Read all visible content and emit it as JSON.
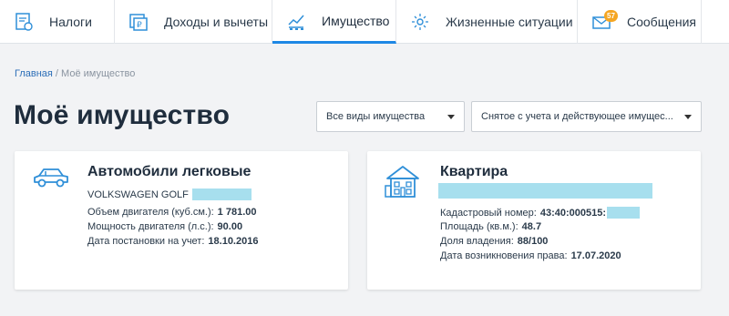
{
  "nav": {
    "items": [
      {
        "label": "Налоги",
        "icon": "tax-doc-icon"
      },
      {
        "label": "Доходы и вычеты",
        "icon": "income-deductions-icon"
      },
      {
        "label": "Имущество",
        "icon": "property-chart-icon",
        "active": true
      },
      {
        "label": "Жизненные ситуации",
        "icon": "life-situations-icon"
      },
      {
        "label": "Сообщения",
        "icon": "messages-envelope-icon",
        "badge": "57"
      }
    ]
  },
  "breadcrumb": {
    "home": "Главная",
    "separator": " / ",
    "current": "Моё имущество"
  },
  "page": {
    "title": "Моё имущество"
  },
  "filters": {
    "type": {
      "value": "Все виды имущества"
    },
    "status": {
      "value": "Снятое с учета и действующее имущес..."
    }
  },
  "cards": {
    "car": {
      "title": "Автомобили легковые",
      "model": "VOLKSWAGEN GOLF",
      "engine_volume_label": "Объем двигателя (куб.см.):",
      "engine_volume_value": "1 781.00",
      "power_label": "Мощность двигателя (л.с.):",
      "power_value": "90.00",
      "registration_label": "Дата постановки на учет:",
      "registration_value": "18.10.2016"
    },
    "flat": {
      "title": "Квартира",
      "cadastral_label": "Кадастровый номер:",
      "cadastral_value": "43:40:000515:",
      "area_label": "Площадь (кв.м.):",
      "area_value": "48.7",
      "share_label": "Доля владения:",
      "share_value": "88/100",
      "rights_label": "Дата возникновения права:",
      "rights_value": "17.07.2020"
    }
  },
  "colors": {
    "accent": "#1e88e5",
    "badge": "#f5a623",
    "redaction": "#a7dfee",
    "icon": "#2f8fd8"
  }
}
